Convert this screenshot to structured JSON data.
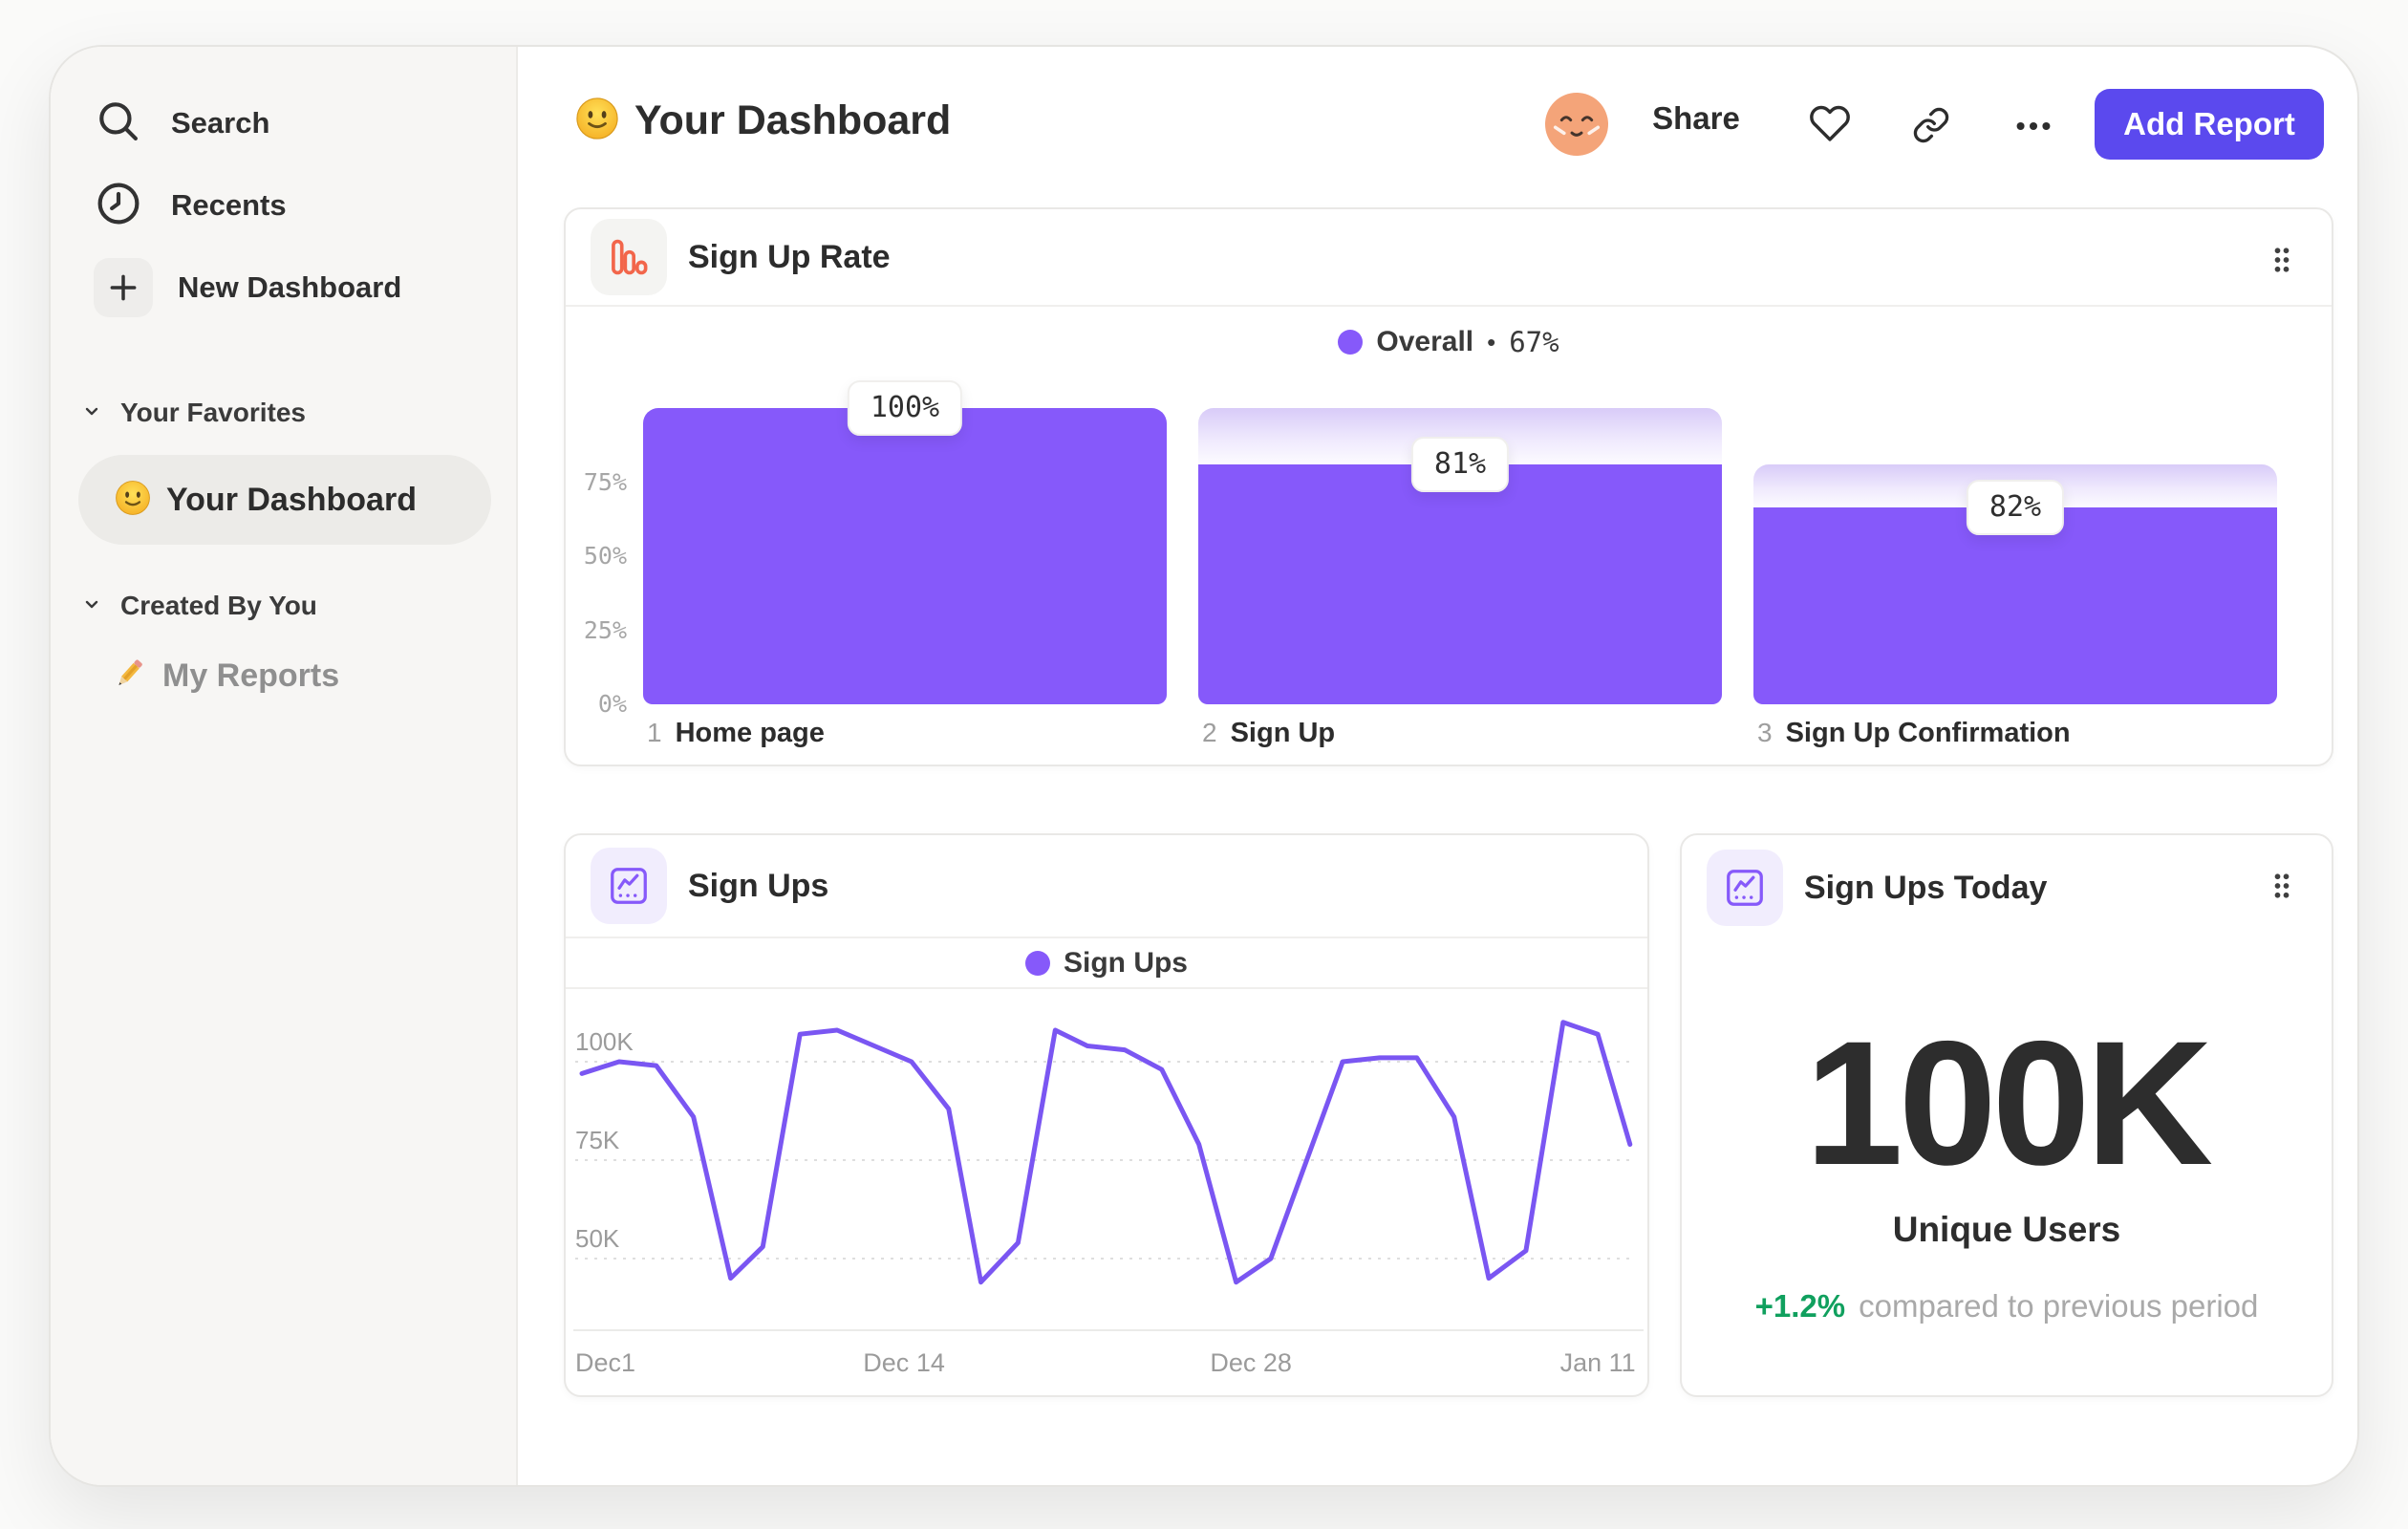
{
  "sidebar": {
    "items": [
      {
        "label": "Search",
        "icon": "search-icon"
      },
      {
        "label": "Recents",
        "icon": "clock-icon"
      },
      {
        "label": "New Dashboard",
        "icon": "plus-icon"
      }
    ],
    "sections": [
      {
        "label": "Your Favorites",
        "children": [
          {
            "label": "Your Dashboard",
            "icon": "smiley-emoji",
            "active": true
          }
        ]
      },
      {
        "label": "Created By You",
        "children": [
          {
            "label": "My Reports",
            "icon": "pencil-emoji",
            "active": false
          }
        ]
      }
    ]
  },
  "header": {
    "title": "Your Dashboard",
    "title_emoji": "smiley-emoji",
    "share_label": "Share",
    "add_report_label": "Add Report"
  },
  "cards": {
    "funnel": {
      "title": "Sign Up Rate"
    },
    "line": {
      "title": "Sign Ups"
    },
    "big_number": {
      "title": "Sign Ups Today"
    }
  },
  "chart_data": [
    {
      "type": "bar",
      "subtype": "funnel",
      "title": "Sign Up Rate",
      "legend": {
        "series": "Overall",
        "separator": "•",
        "value_display": "67%",
        "overall_conversion_pct": 67
      },
      "steps": [
        {
          "index": 1,
          "label": "Home page",
          "conversion_from_previous_pct": 100,
          "conversion_display": "100%"
        },
        {
          "index": 2,
          "label": "Sign Up",
          "conversion_from_previous_pct": 81,
          "conversion_display": "81%"
        },
        {
          "index": 3,
          "label": "Sign Up Confirmation",
          "conversion_from_previous_pct": 82,
          "conversion_display": "82%"
        }
      ],
      "y_ticks": [
        {
          "label": "75%",
          "pct": 75
        },
        {
          "label": "50%",
          "pct": 50
        },
        {
          "label": "25%",
          "pct": 25
        },
        {
          "label": "0%",
          "pct": 0
        }
      ],
      "ylim": [
        0,
        100
      ],
      "bar_color": "#8659fa"
    },
    {
      "type": "line",
      "title": "Sign Ups",
      "series": [
        {
          "name": "Sign Ups",
          "points_day_valueK": [
            [
              0,
              97
            ],
            [
              1.5,
              100
            ],
            [
              3,
              99
            ],
            [
              4.5,
              86
            ],
            [
              6,
              45
            ],
            [
              7.3,
              53
            ],
            [
              8.8,
              107
            ],
            [
              10.3,
              108
            ],
            [
              13.3,
              100
            ],
            [
              14.8,
              88
            ],
            [
              16.1,
              44
            ],
            [
              17.6,
              54
            ],
            [
              19.1,
              108
            ],
            [
              20.4,
              104
            ],
            [
              21.9,
              103
            ],
            [
              23.4,
              98
            ],
            [
              24.9,
              79
            ],
            [
              26.4,
              44
            ],
            [
              27.8,
              50
            ],
            [
              30.7,
              100
            ],
            [
              32.2,
              101
            ],
            [
              33.7,
              101
            ],
            [
              35.2,
              86
            ],
            [
              36.6,
              45
            ],
            [
              38.1,
              52
            ],
            [
              39.6,
              110
            ],
            [
              41,
              107
            ],
            [
              42.3,
              79
            ]
          ]
        }
      ],
      "x_ticks": [
        {
          "label": "Dec1",
          "day": 0
        },
        {
          "label": "Dec 14",
          "day": 13
        },
        {
          "label": "Dec 28",
          "day": 27
        },
        {
          "label": "Jan 11",
          "day": 41
        }
      ],
      "y_ticks": [
        {
          "label": "50K",
          "value": 50
        },
        {
          "label": "75K",
          "value": 75
        },
        {
          "label": "100K",
          "value": 100
        }
      ],
      "x_domain_days": [
        0,
        43.5
      ],
      "grid": "dashed-horizontal",
      "legend_position": "top-center",
      "line_color": "#7a56f2"
    },
    {
      "type": "big_number",
      "title": "Sign Ups Today",
      "value": "100K",
      "metric": "Unique Users",
      "delta": "+1.2%",
      "comparison": "compared to previous period"
    }
  ],
  "colors": {
    "accent_purple": "#8659fa",
    "line_purple": "#7a56f2",
    "button_purple": "#5b49ee",
    "funnel_icon_orange": "#f2664b",
    "delta_green": "#10a05e",
    "sidebar_bg": "#f7f6f4",
    "card_border": "#e9e8e6"
  }
}
